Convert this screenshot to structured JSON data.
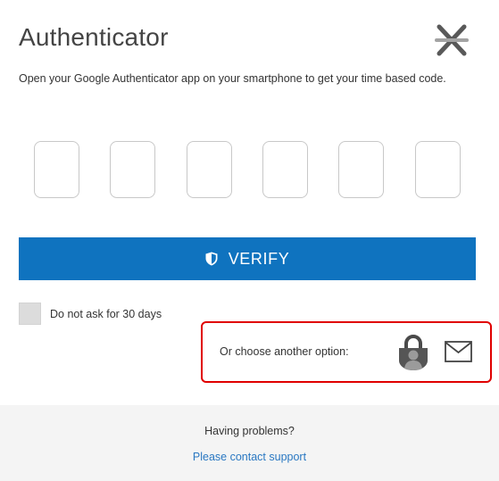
{
  "header": {
    "title": "Authenticator",
    "subtitle": "Open your Google Authenticator app on your smartphone to get your time based code."
  },
  "code": {
    "digits": [
      "",
      "",
      "",
      "",
      "",
      ""
    ]
  },
  "verify": {
    "label": "VERIFY",
    "icon": "shield-icon",
    "color": "#0f73bf"
  },
  "remember": {
    "label": "Do not ask for 30 days",
    "checked": false
  },
  "options": {
    "label": "Or choose another option:",
    "icons": [
      "lock-user-icon",
      "envelope-icon"
    ],
    "highlight_color": "#e00000"
  },
  "footer": {
    "question": "Having problems?",
    "link": "Please contact support"
  },
  "logo": {
    "icon": "asterisk-logo-icon",
    "colors": [
      "#555555",
      "#a0a0a0"
    ]
  }
}
